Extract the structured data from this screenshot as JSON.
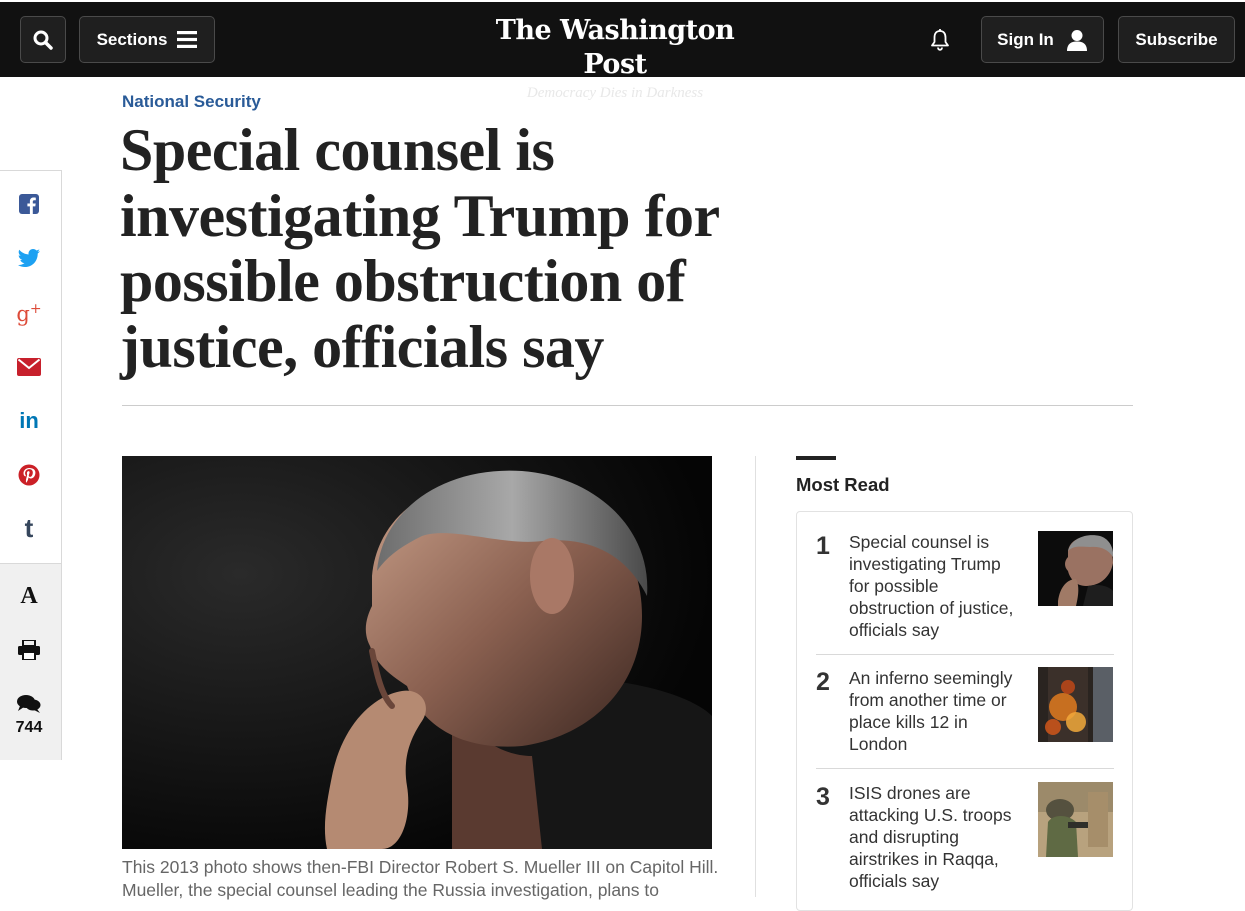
{
  "header": {
    "sections_label": "Sections",
    "logo_name": "The Washington Post",
    "logo_tagline": "Democracy Dies in Darkness",
    "signin_label": "Sign In",
    "subscribe_label": "Subscribe",
    "background_color": "#111111"
  },
  "article": {
    "kicker": "National Security",
    "kicker_color": "#2a5b98",
    "headline": "Special counsel is investigating Trump for possible obstruction of justice, officials say",
    "caption": "This 2013 photo shows then-FBI Director Robert S. Mueller III on Capitol Hill. Mueller, the special counsel leading the Russia investigation, plans to"
  },
  "share_rail": {
    "icons": [
      "facebook-icon",
      "twitter-icon",
      "google-plus-icon",
      "email-icon",
      "linkedin-icon",
      "pinterest-icon",
      "tumblr-icon"
    ],
    "tools": [
      "text-size-icon",
      "print-icon",
      "comments-icon"
    ],
    "comment_count": "744"
  },
  "most_read": {
    "title": "Most Read",
    "items": [
      {
        "rank": "1",
        "title": "Special counsel is investigating Trump for possible obstruction of justice, officials say"
      },
      {
        "rank": "2",
        "title": "An inferno seemingly from another time or place kills 12 in London"
      },
      {
        "rank": "3",
        "title": "ISIS drones are attacking U.S. troops and disrupting airstrikes in Raqqa, officials say"
      }
    ]
  }
}
